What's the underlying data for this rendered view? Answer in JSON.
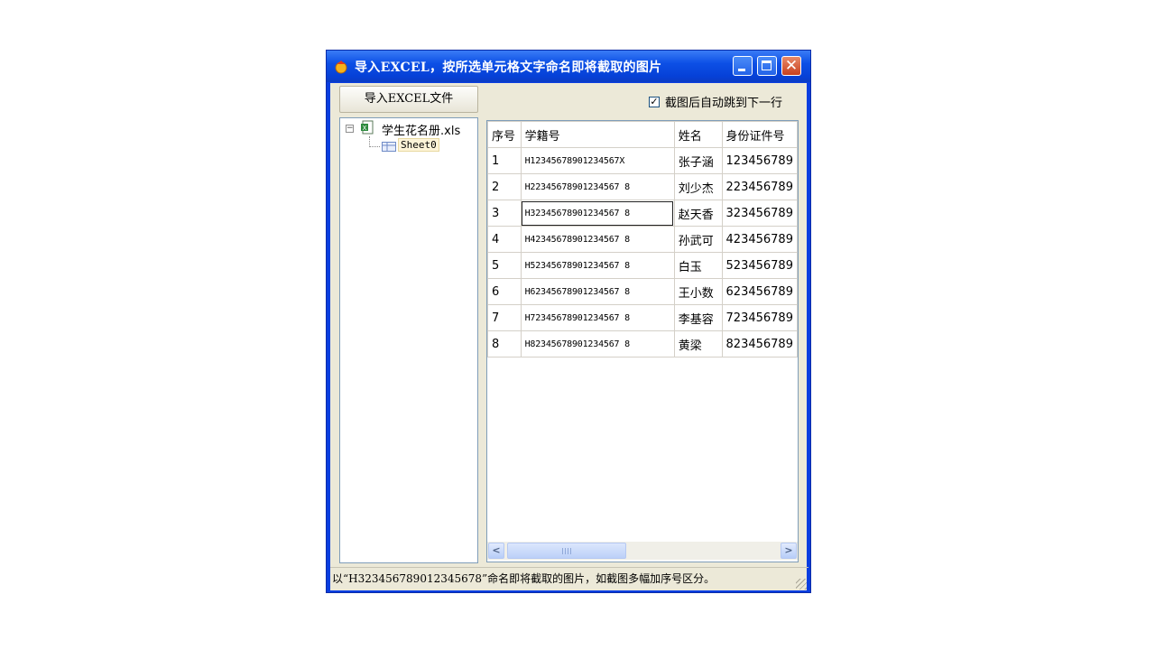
{
  "window": {
    "title": "导入EXCEL，按所选单元格文字命名即将截取的图片",
    "minimize_label": "",
    "close_glyph": "✕"
  },
  "toolbar": {
    "import_button": "导入EXCEL文件",
    "auto_jump_checked": true,
    "auto_jump_label": "截图后自动跳到下一行"
  },
  "tree": {
    "root": "学生花名册.xls",
    "children": [
      "Sheet0"
    ]
  },
  "table": {
    "columns": [
      "序号",
      "学籍号",
      "姓名",
      "身份证件号"
    ],
    "rows": [
      [
        "1",
        "H12345678901234567X",
        "张子涵",
        "123456789"
      ],
      [
        "2",
        "H22345678901234567 8",
        "刘少杰",
        "223456789"
      ],
      [
        "3",
        "H32345678901234567 8",
        "赵天香",
        "323456789"
      ],
      [
        "4",
        "H42345678901234567 8",
        "孙武可",
        "423456789"
      ],
      [
        "5",
        "H52345678901234567 8",
        "白玉",
        "523456789"
      ],
      [
        "6",
        "H62345678901234567 8",
        "王小数",
        "623456789"
      ],
      [
        "7",
        "H72345678901234567 8",
        "李基容",
        "723456789"
      ],
      [
        "8",
        "H82345678901234567 8",
        "黄梁",
        "823456789"
      ]
    ],
    "selected_row": 2,
    "selected_col": 1
  },
  "status": {
    "text": "以“H323456789012345678”命名即将截取的图片，如截图多幅加序号区分。"
  },
  "colors": {
    "titlebar": "#0d50e6",
    "client": "#ece9d8",
    "close_button": "#c8401e"
  }
}
